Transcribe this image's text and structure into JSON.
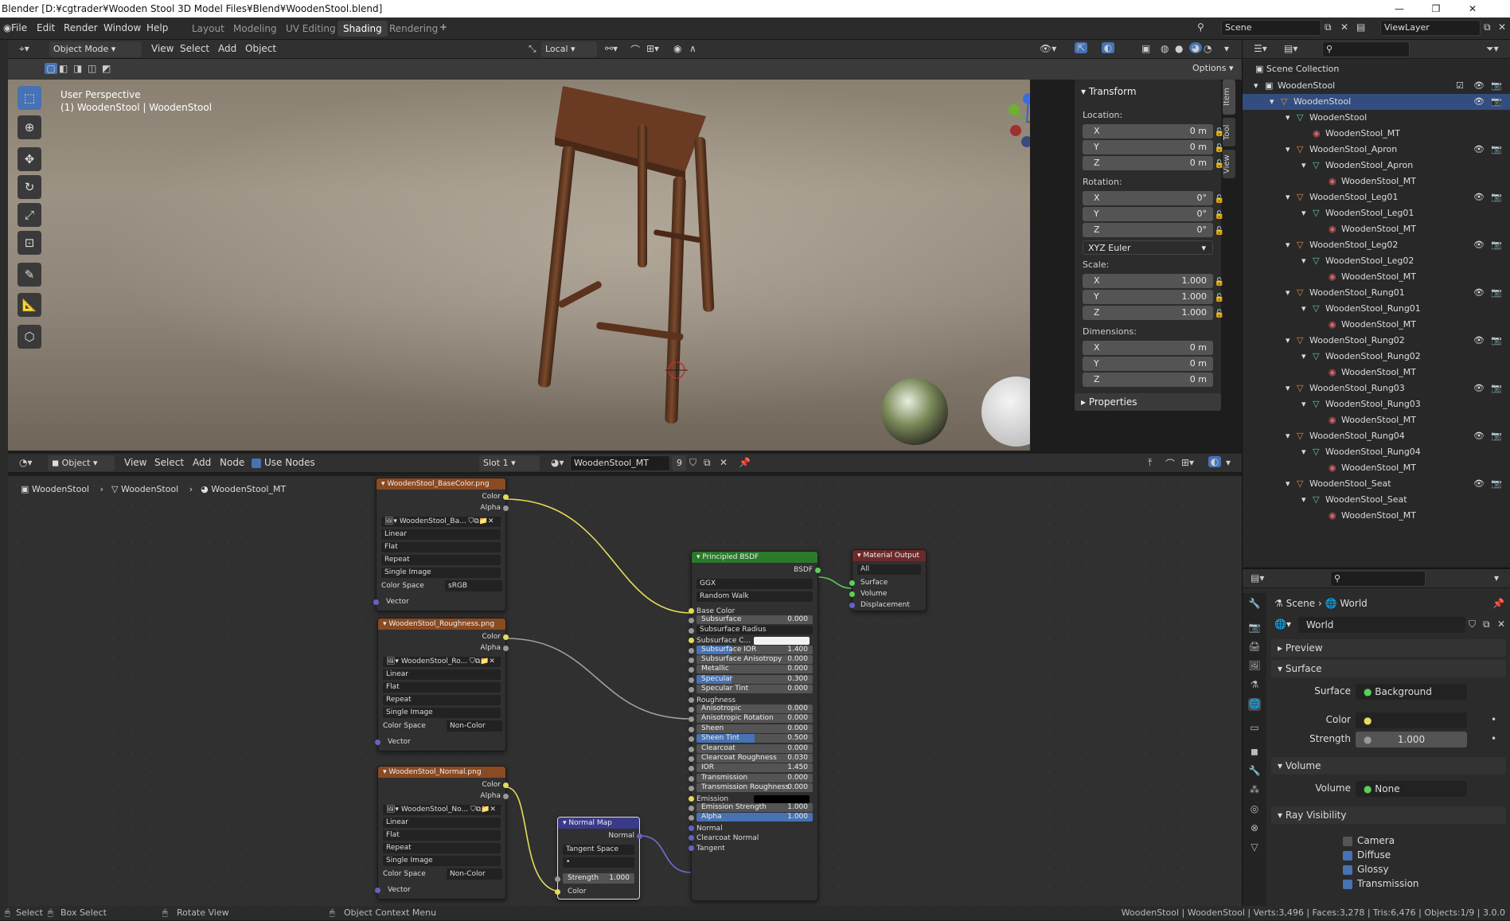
{
  "window": {
    "title": "Blender [D:¥cgtrader¥Wooden Stool 3D Model Files¥Blend¥WoodenStool.blend]"
  },
  "menu": [
    "File",
    "Edit",
    "Render",
    "Window",
    "Help"
  ],
  "workspaces": [
    "Layout",
    "Modeling",
    "UV Editing",
    "Shading",
    "Rendering"
  ],
  "active_workspace": "Shading",
  "scene": {
    "name": "Scene",
    "view_layer": "ViewLayer"
  },
  "viewport": {
    "mode": "Object Mode",
    "menus": [
      "View",
      "Select",
      "Add",
      "Object"
    ],
    "orientation": "Local",
    "options_label": "Options",
    "info_line1": "User Perspective",
    "info_line2": "(1) WoodenStool | WoodenStool"
  },
  "npanel": {
    "title": "Transform",
    "location_label": "Location:",
    "location": [
      {
        "axis": "X",
        "value": "0 m"
      },
      {
        "axis": "Y",
        "value": "0 m"
      },
      {
        "axis": "Z",
        "value": "0 m"
      }
    ],
    "rotation_label": "Rotation:",
    "rotation": [
      {
        "axis": "X",
        "value": "0°"
      },
      {
        "axis": "Y",
        "value": "0°"
      },
      {
        "axis": "Z",
        "value": "0°"
      }
    ],
    "rotation_mode": "XYZ Euler",
    "scale_label": "Scale:",
    "scale": [
      {
        "axis": "X",
        "value": "1.000"
      },
      {
        "axis": "Y",
        "value": "1.000"
      },
      {
        "axis": "Z",
        "value": "1.000"
      }
    ],
    "dimensions_label": "Dimensions:",
    "dimensions": [
      {
        "axis": "X",
        "value": "0 m"
      },
      {
        "axis": "Y",
        "value": "0 m"
      },
      {
        "axis": "Z",
        "value": "0 m"
      }
    ],
    "properties_label": "Properties",
    "tabs": [
      "Item",
      "Tool",
      "View"
    ]
  },
  "outliner": {
    "root": "Scene Collection",
    "rows": [
      {
        "label": "WoodenStool",
        "depth": 0,
        "type": "collection"
      },
      {
        "label": "WoodenStool",
        "depth": 1,
        "type": "object",
        "selected": true
      },
      {
        "label": "WoodenStool",
        "depth": 2,
        "type": "mesh"
      },
      {
        "label": "WoodenStool_MT",
        "depth": 3,
        "type": "material"
      },
      {
        "label": "WoodenStool_Apron",
        "depth": 2,
        "type": "object"
      },
      {
        "label": "WoodenStool_Apron",
        "depth": 3,
        "type": "mesh"
      },
      {
        "label": "WoodenStool_MT",
        "depth": 4,
        "type": "material"
      },
      {
        "label": "WoodenStool_Leg01",
        "depth": 2,
        "type": "object"
      },
      {
        "label": "WoodenStool_Leg01",
        "depth": 3,
        "type": "mesh"
      },
      {
        "label": "WoodenStool_MT",
        "depth": 4,
        "type": "material"
      },
      {
        "label": "WoodenStool_Leg02",
        "depth": 2,
        "type": "object"
      },
      {
        "label": "WoodenStool_Leg02",
        "depth": 3,
        "type": "mesh"
      },
      {
        "label": "WoodenStool_MT",
        "depth": 4,
        "type": "material"
      },
      {
        "label": "WoodenStool_Rung01",
        "depth": 2,
        "type": "object"
      },
      {
        "label": "WoodenStool_Rung01",
        "depth": 3,
        "type": "mesh"
      },
      {
        "label": "WoodenStool_MT",
        "depth": 4,
        "type": "material"
      },
      {
        "label": "WoodenStool_Rung02",
        "depth": 2,
        "type": "object"
      },
      {
        "label": "WoodenStool_Rung02",
        "depth": 3,
        "type": "mesh"
      },
      {
        "label": "WoodenStool_MT",
        "depth": 4,
        "type": "material"
      },
      {
        "label": "WoodenStool_Rung03",
        "depth": 2,
        "type": "object"
      },
      {
        "label": "WoodenStool_Rung03",
        "depth": 3,
        "type": "mesh"
      },
      {
        "label": "WoodenStool_MT",
        "depth": 4,
        "type": "material"
      },
      {
        "label": "WoodenStool_Rung04",
        "depth": 2,
        "type": "object"
      },
      {
        "label": "WoodenStool_Rung04",
        "depth": 3,
        "type": "mesh"
      },
      {
        "label": "WoodenStool_MT",
        "depth": 4,
        "type": "material"
      },
      {
        "label": "WoodenStool_Seat",
        "depth": 2,
        "type": "object"
      },
      {
        "label": "WoodenStool_Seat",
        "depth": 3,
        "type": "mesh"
      },
      {
        "label": "WoodenStool_MT",
        "depth": 4,
        "type": "material"
      }
    ]
  },
  "properties": {
    "breadcrumb_scene": "Scene",
    "breadcrumb_world": "World",
    "world_name": "World",
    "sections": {
      "preview": "Preview",
      "surface": "Surface",
      "volume": "Volume",
      "ray_visibility": "Ray Visibility"
    },
    "surface_label": "Surface",
    "surface_value": "Background",
    "color_label": "Color",
    "strength_label": "Strength",
    "strength_value": "1.000",
    "volume_label": "Volume",
    "volume_value": "None",
    "ray": [
      {
        "label": "Camera",
        "checked": false
      },
      {
        "label": "Diffuse",
        "checked": true
      },
      {
        "label": "Glossy",
        "checked": true
      },
      {
        "label": "Transmission",
        "checked": true
      }
    ]
  },
  "node_editor": {
    "type": "Object",
    "menus": [
      "View",
      "Select",
      "Add",
      "Node"
    ],
    "use_nodes": "Use Nodes",
    "slot": "Slot 1",
    "material": "WoodenStool_MT",
    "users": "9",
    "breadcrumb": [
      "WoodenStool",
      "WoodenStool",
      "WoodenStool_MT"
    ]
  },
  "nodes": {
    "basecolor": {
      "title": "WoodenStool_BaseColor.png",
      "image": "WoodenStool_Ba...",
      "interp": "Linear",
      "proj": "Flat",
      "ext": "Repeat",
      "src": "Single Image",
      "cs_label": "Color Space",
      "cs": "sRGB"
    },
    "roughness": {
      "title": "WoodenStool_Roughness.png",
      "image": "WoodenStool_Ro...",
      "interp": "Linear",
      "proj": "Flat",
      "ext": "Repeat",
      "src": "Single Image",
      "cs_label": "Color Space",
      "cs": "Non-Color"
    },
    "normal": {
      "title": "WoodenStool_Normal.png",
      "image": "WoodenStool_No...",
      "interp": "Linear",
      "proj": "Flat",
      "ext": "Repeat",
      "src": "Single Image",
      "cs_label": "Color Space",
      "cs": "Non-Color"
    },
    "sock_color": "Color",
    "sock_alpha": "Alpha",
    "sock_vector": "Vector",
    "normalmap": {
      "title": "Normal Map",
      "out": "Normal",
      "space": "Tangent Space",
      "strength_label": "Strength",
      "strength": "1.000",
      "in": "Color"
    },
    "bsdf": {
      "title": "Principled BSDF",
      "out": "BSDF",
      "dist": "GGX",
      "sss": "Random Walk",
      "rows": [
        {
          "label": "Base Color",
          "kind": "socket"
        },
        {
          "label": "Subsurface",
          "value": "0.000"
        },
        {
          "label": "Subsurface Radius",
          "kind": "dropdown"
        },
        {
          "label": "Subsurface C...",
          "kind": "color"
        },
        {
          "label": "Subsurface IOR",
          "value": "1.400",
          "fill": 0.3
        },
        {
          "label": "Subsurface Anisotropy",
          "value": "0.000"
        },
        {
          "label": "Metallic",
          "value": "0.000"
        },
        {
          "label": "Specular",
          "value": "0.300",
          "fill": 0.3
        },
        {
          "label": "Specular Tint",
          "value": "0.000"
        },
        {
          "label": "Roughness",
          "kind": "socket"
        },
        {
          "label": "Anisotropic",
          "value": "0.000"
        },
        {
          "label": "Anisotropic Rotation",
          "value": "0.000"
        },
        {
          "label": "Sheen",
          "value": "0.000"
        },
        {
          "label": "Sheen Tint",
          "value": "0.500",
          "fill": 0.5
        },
        {
          "label": "Clearcoat",
          "value": "0.000"
        },
        {
          "label": "Clearcoat Roughness",
          "value": "0.030"
        },
        {
          "label": "IOR",
          "value": "1.450"
        },
        {
          "label": "Transmission",
          "value": "0.000"
        },
        {
          "label": "Transmission Roughness",
          "value": "0.000"
        },
        {
          "label": "Emission",
          "kind": "black"
        },
        {
          "label": "Emission Strength",
          "value": "1.000"
        },
        {
          "label": "Alpha",
          "value": "1.000",
          "fill": 1.0
        },
        {
          "label": "Normal",
          "kind": "socket"
        },
        {
          "label": "Clearcoat Normal",
          "kind": "socket"
        },
        {
          "label": "Tangent",
          "kind": "socket"
        }
      ]
    },
    "output": {
      "title": "Material Output",
      "target": "All",
      "in": [
        "Surface",
        "Volume",
        "Displacement"
      ]
    }
  },
  "status": {
    "left": [
      "Select",
      "Box Select",
      "Rotate View",
      "Object Context Menu"
    ],
    "right": "WoodenStool | WoodenStool | Verts:3,496 | Faces:3,278 | Tris:6,476 | Objects:1/9 | 3.0.0"
  },
  "colors": {
    "accent": "#4772b3",
    "node_texture": "#8a4a22",
    "node_shader": "#2a7a2a",
    "node_output": "#6b2a2a",
    "node_vector": "#3a3a8a",
    "wire_color": "#e6dc5a",
    "wire_gray": "#a0a0a0",
    "wire_green": "#5ad05a",
    "wire_purple": "#7070d0"
  }
}
